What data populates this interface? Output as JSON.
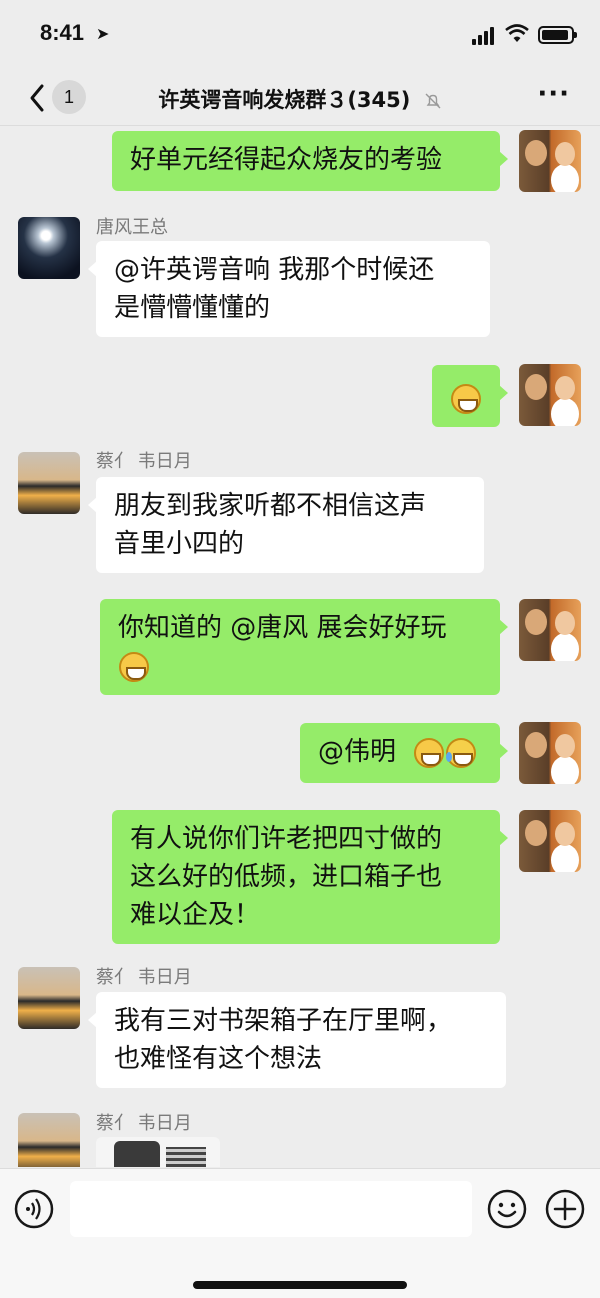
{
  "status_bar": {
    "time": "8:41"
  },
  "nav": {
    "back_badge": "1",
    "title": "许英谔音响发烧群３(345)"
  },
  "messages": [
    {
      "side": "out",
      "text": "好单元经得起众烧友的考验"
    },
    {
      "side": "in",
      "sender": "唐风王总",
      "text_line1": "@许英谔音响 我那个时候还",
      "text_line2": "是懵懵懂懂的"
    },
    {
      "side": "out",
      "emoji": "grin"
    },
    {
      "side": "in",
      "sender": "蔡亻 韦日月",
      "text_line1": "朋友到我家听都不相信这声",
      "text_line2": "音里小四的"
    },
    {
      "side": "out",
      "text_line1": "你知道的 @唐风 展会好好玩"
    },
    {
      "side": "out",
      "text": "@伟明"
    },
    {
      "side": "out",
      "text_line1": "有人说你们许老把四寸做的",
      "text_line2": "这么好的低频，进口箱子也",
      "text_line3": "难以企及！"
    },
    {
      "side": "in",
      "sender": "蔡亻 韦日月",
      "text_line1": "我有三对书架箱子在厅里啊，",
      "text_line2": "也难怪有这个想法"
    },
    {
      "side": "in",
      "sender": "蔡亻 韦日月",
      "content": "image"
    }
  ],
  "icons": {
    "voice": "voice-icon",
    "emoji": "smile-icon",
    "more": "plus-icon"
  },
  "colors": {
    "outgoing_bubble": "#95ec69",
    "incoming_bubble": "#ffffff",
    "background": "#ededed"
  }
}
